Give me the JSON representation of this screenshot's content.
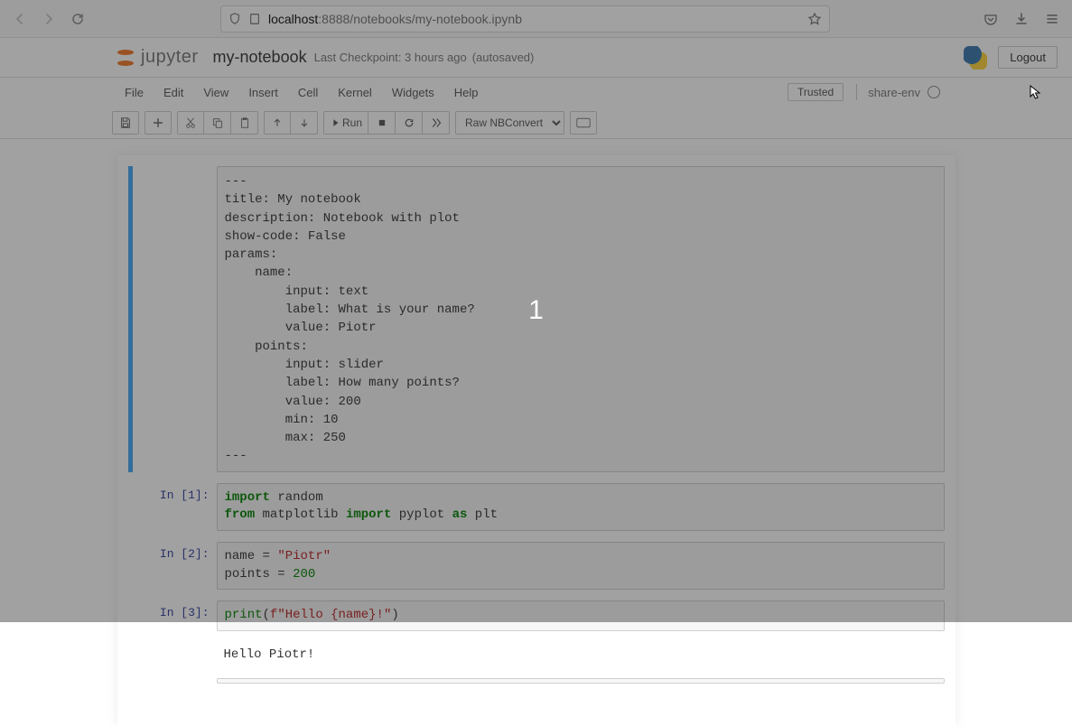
{
  "browser": {
    "url_host": "localhost",
    "url_rest": ":8888/notebooks/my-notebook.ipynb"
  },
  "header": {
    "logo_text": "jupyter",
    "notebook_title": "my-notebook",
    "checkpoint": "Last Checkpoint: 3 hours ago",
    "autosaved": "(autosaved)",
    "logout": "Logout"
  },
  "menus": [
    "File",
    "Edit",
    "View",
    "Insert",
    "Cell",
    "Kernel",
    "Widgets",
    "Help"
  ],
  "trusted": "Trusted",
  "kernel_name": "share-env",
  "toolbar": {
    "run_label": "Run",
    "celltype": "Raw NBConvert"
  },
  "cells": {
    "raw": "---\ntitle: My notebook\ndescription: Notebook with plot\nshow-code: False\nparams:\n    name:\n        input: text\n        label: What is your name?\n        value: Piotr\n    points:\n        input: slider\n        label: How many points?\n        value: 200\n        min: 10\n        max: 250\n---",
    "c1_prompt": "In [1]:",
    "c2_prompt": "In [2]:",
    "c3_prompt": "In [3]:",
    "c1": {
      "t1": "import",
      "t2": " random",
      "t3": "from",
      "t4": " matplotlib ",
      "t5": "import",
      "t6": " pyplot ",
      "t7": "as",
      "t8": " plt"
    },
    "c2": {
      "t1": "name = ",
      "t2": "\"Piotr\"",
      "t3": "points = ",
      "t4": "200"
    },
    "c3": {
      "t1": "print",
      "t2": "(",
      "t3": "f\"Hello {name}!\"",
      "t4": ")"
    },
    "out3": "Hello Piotr!"
  },
  "overlay_number": "1"
}
